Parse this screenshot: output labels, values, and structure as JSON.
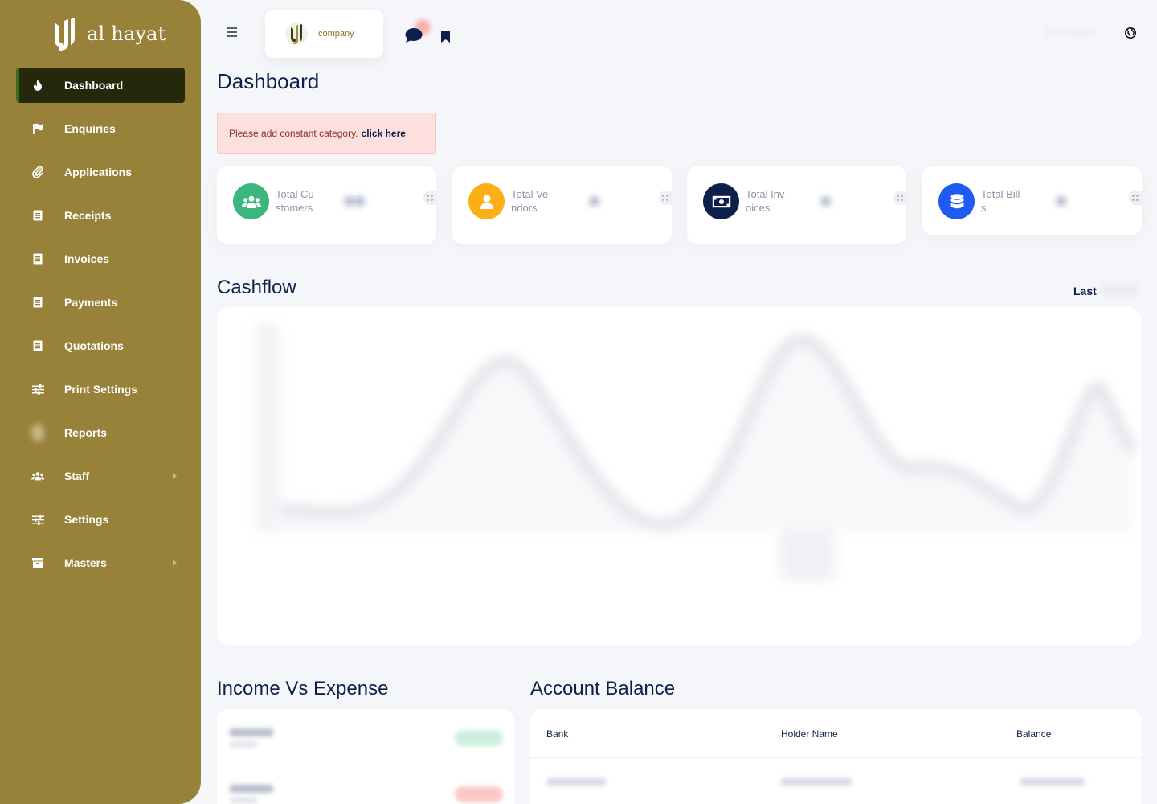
{
  "brand": {
    "name": "al hayat"
  },
  "sidebar": {
    "items": [
      {
        "label": "Dashboard",
        "icon": "fire-icon",
        "active": true
      },
      {
        "label": "Enquiries",
        "icon": "flag-icon"
      },
      {
        "label": "Applications",
        "icon": "paperclip-icon"
      },
      {
        "label": "Receipts",
        "icon": "document-icon"
      },
      {
        "label": "Invoices",
        "icon": "document-icon"
      },
      {
        "label": "Payments",
        "icon": "document-icon"
      },
      {
        "label": "Quotations",
        "icon": "document-icon"
      },
      {
        "label": "Print Settings",
        "icon": "sliders-icon"
      },
      {
        "label": "Reports",
        "icon": "reports-icon"
      },
      {
        "label": "Staff",
        "icon": "users-icon",
        "has_submenu": true
      },
      {
        "label": "Settings",
        "icon": "sliders-icon"
      },
      {
        "label": "Masters",
        "icon": "archive-icon",
        "has_submenu": true
      }
    ]
  },
  "topbar": {
    "company_label": "company",
    "dark_mode_label": "Dark Mode"
  },
  "page": {
    "title": "Dashboard"
  },
  "alert": {
    "text": "Please add constant category.",
    "link": "click here"
  },
  "stats": [
    {
      "label": "Total Customers",
      "icon": "users-icon",
      "color": "#3bb77e"
    },
    {
      "label": "Total Vendors",
      "icon": "user-icon",
      "color": "#fcb017"
    },
    {
      "label": "Total Invoices",
      "icon": "banknote-icon",
      "color": "#0f1f4b"
    },
    {
      "label": "Total Bills",
      "icon": "database-icon",
      "color": "#1e5bf0"
    }
  ],
  "cashflow": {
    "title": "Cashflow",
    "filter_label": "Last"
  },
  "income_expense": {
    "title": "Income Vs Expense"
  },
  "account_balance": {
    "title": "Account Balance",
    "columns": [
      "Bank",
      "Holder Name",
      "Balance"
    ]
  },
  "colors": {
    "sidebar": "#98823a",
    "sidebar_active": "#26280b",
    "accent": "#0f1f4b",
    "background": "#f5f6fa"
  }
}
